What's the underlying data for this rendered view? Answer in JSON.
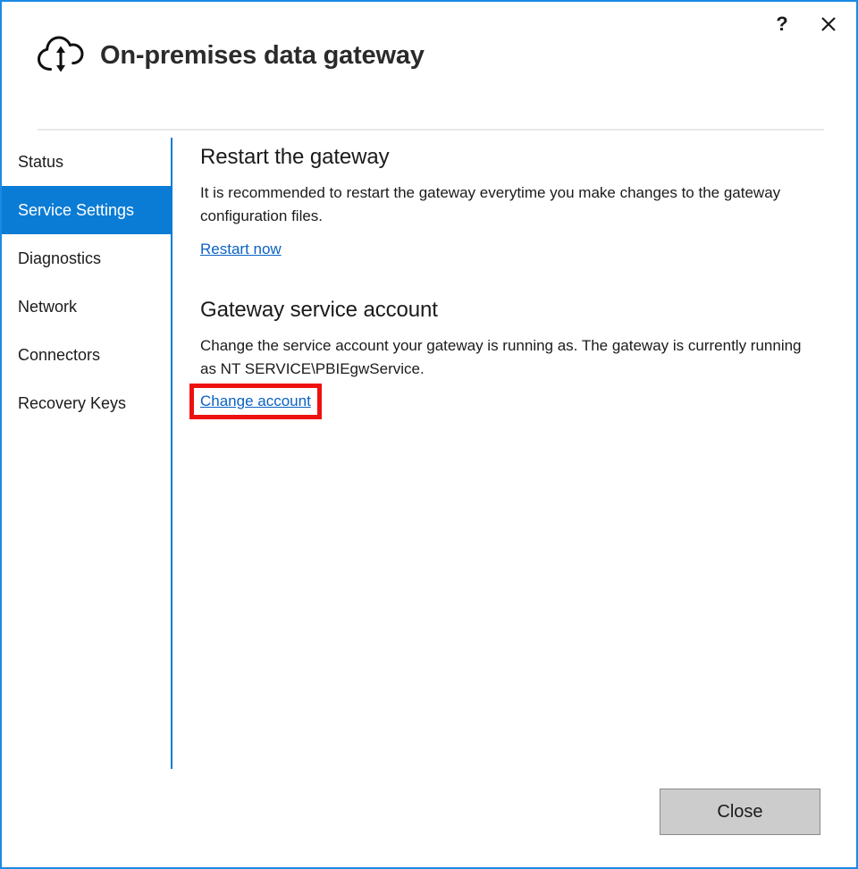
{
  "window": {
    "title": "On-premises data gateway",
    "brand_icon": "cloud-sync-icon",
    "accent_color": "#0b7cd5",
    "border_color": "#1a8ae5",
    "controls": {
      "help_label": "?",
      "help_icon": "help-question-icon",
      "close_icon": "close-x-icon"
    }
  },
  "sidebar": {
    "items": [
      {
        "label": "Status",
        "selected": false
      },
      {
        "label": "Service Settings",
        "selected": true
      },
      {
        "label": "Diagnostics",
        "selected": false
      },
      {
        "label": "Network",
        "selected": false
      },
      {
        "label": "Connectors",
        "selected": false
      },
      {
        "label": "Recovery Keys",
        "selected": false
      }
    ]
  },
  "content": {
    "restart": {
      "heading": "Restart the gateway",
      "body": "It is recommended to restart the gateway everytime you make changes to the gateway configuration files.",
      "link": "Restart now"
    },
    "account": {
      "heading": "Gateway service account",
      "body": "Change the service account your gateway is running as. The gateway is currently running as NT SERVICE\\PBIEgwService.",
      "link": "Change account",
      "link_highlight_color": "#ee1111"
    }
  },
  "footer": {
    "close_label": "Close"
  }
}
